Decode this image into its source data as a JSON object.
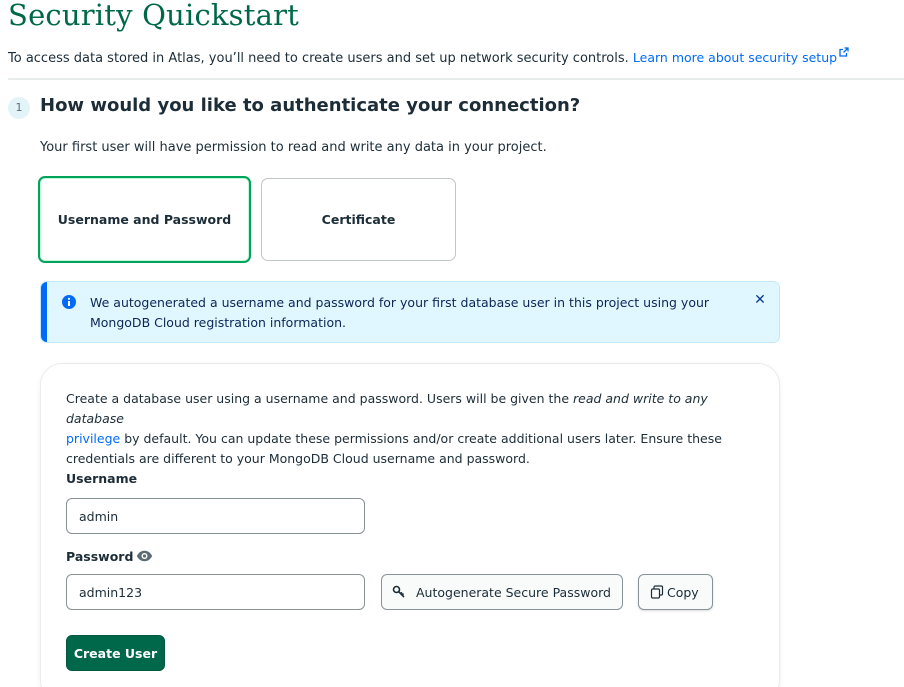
{
  "page": {
    "title": "Security Quickstart",
    "intro_text": "To access data stored in Atlas, you’ll need to create users and set up network security controls.",
    "intro_link": "Learn more about security setup"
  },
  "step": {
    "number": "1",
    "heading": "How would you like to authenticate your connection?",
    "subtext": "Your first user will have permission to read and write any data in your project."
  },
  "auth_options": {
    "username_password": "Username and Password",
    "certificate": "Certificate",
    "selected": "Username and Password"
  },
  "banner": {
    "text": "We autogenerated a username and password for your first database user in this project using your MongoDB Cloud registration information.",
    "icon": "info-icon",
    "close_icon": "close-icon"
  },
  "form": {
    "desc_part1": "Create a database user using a username and password. Users will be given the ",
    "desc_emphasis": "read and write to any database",
    "desc_link": "privilege",
    "desc_part2": " by default. You can update these permissions and/or create additional users later. Ensure these credentials are different to your MongoDB Cloud username and password.",
    "username_label": "Username",
    "username_value": "admin",
    "password_label": "Password",
    "password_value": "admin123",
    "autogenerate_label": "Autogenerate Secure Password",
    "copy_label": "Copy",
    "create_label": "Create User"
  },
  "colors": {
    "brand_green": "#00684a",
    "selected_border": "#00a35c",
    "link_blue": "#016bf8",
    "banner_bg": "#e1f7ff"
  }
}
